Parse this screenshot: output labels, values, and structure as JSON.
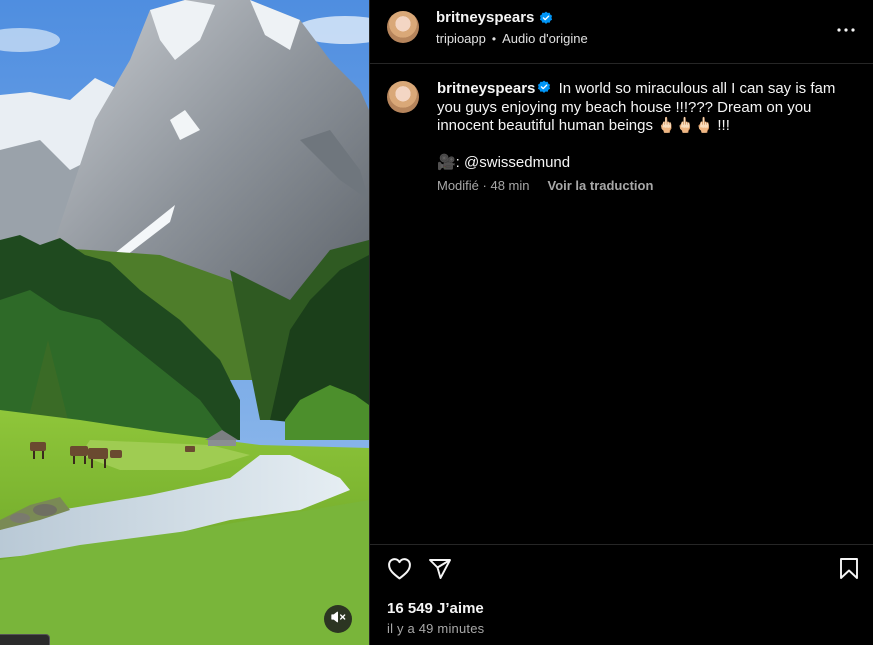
{
  "post": {
    "username": "britneyspears",
    "verified": true,
    "sub": {
      "account": "tripioapp",
      "separator": "•",
      "audio": "Audio d'origine"
    }
  },
  "caption": {
    "username": "britneyspears",
    "text": "In world so miraculous all I can say is fam you guys enjoying my beach house !!!??? Dream on you innocent beautiful human beings 🖕🏻🖕🏻🖕🏻 !!!",
    "credit": "🎥: @swissedmund",
    "edited": "Modifié · 48 min",
    "translate": "Voir la traduction"
  },
  "stats": {
    "likes": "16 549 J’aime",
    "timestamp": "il y a 49 minutes"
  },
  "icons": {
    "more": "more-options-icon",
    "like": "heart-icon",
    "share": "share-icon",
    "save": "bookmark-icon",
    "mute": "speaker-muted-icon",
    "verified": "verified-badge-icon"
  },
  "colors": {
    "background": "#000000",
    "text": "#f5f5f5",
    "secondary": "#a8a8a8",
    "verified": "#0095f6",
    "divider": "#262626"
  }
}
